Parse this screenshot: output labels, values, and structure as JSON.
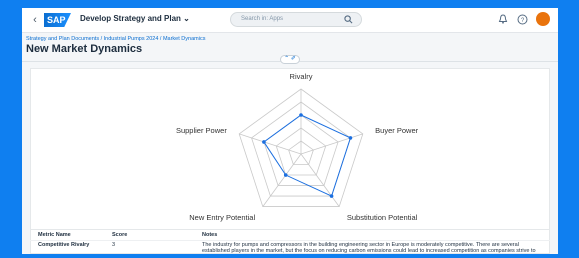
{
  "shell": {
    "logo": "SAP",
    "app_title": "Develop Strategy and Plan ⌄",
    "search_placeholder": "Search in: Apps",
    "icons": [
      "back-icon",
      "search-icon",
      "notification-icon",
      "help-icon",
      "avatar"
    ]
  },
  "breadcrumb": "Strategy and Plan Documents / Industrial Pumps 2024 / Market Dynamics",
  "page_title": "New Market Dynamics",
  "chart_data": {
    "type": "radar",
    "axes": [
      "Rivalry",
      "Buyer Power",
      "Substitution Potential",
      "New Entry Potential",
      "Supplier Power"
    ],
    "series": [
      {
        "values": [
          3,
          4,
          4,
          2,
          3
        ]
      }
    ],
    "range": [
      0,
      5
    ],
    "rings": 5,
    "line_color": "#1b6fe0"
  },
  "table": {
    "headers": [
      "Metric Name",
      "Score",
      "Notes"
    ],
    "rows": [
      {
        "metric": "Competitive Rivalry",
        "score": "3",
        "notes": "The industry for pumps and compressors in the building engineering sector in Europe is moderately competitive. There are several established players in the market, but the focus on reducing carbon emissions could lead to increased competition as companies strive to innovate and offer more energy-efficient products."
      }
    ]
  }
}
